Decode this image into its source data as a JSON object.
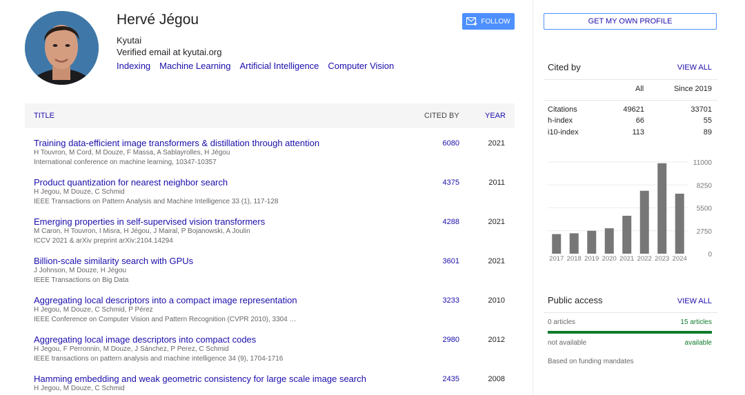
{
  "profile": {
    "name": "Hervé Jégou",
    "affiliation": "Kyutai",
    "email": "Verified email at kyutai.org",
    "interests": [
      "Indexing",
      "Machine Learning",
      "Artificial Intelligence",
      "Computer Vision"
    ],
    "follow_label": "FOLLOW"
  },
  "table": {
    "col_title": "TITLE",
    "col_cited": "CITED BY",
    "col_year": "YEAR",
    "rows": [
      {
        "title": "Training data-efficient image transformers & distillation through attention",
        "authors": "H Touvron, M Cord, M Douze, F Massa, A Sablayrolles, H Jégou",
        "venue": "International conference on machine learning, 10347-10357",
        "cited": "6080",
        "year": "2021"
      },
      {
        "title": "Product quantization for nearest neighbor search",
        "authors": "H Jegou, M Douze, C Schmid",
        "venue": "IEEE Transactions on Pattern Analysis and Machine Intelligence 33 (1), 117-128",
        "cited": "4375",
        "year": "2011"
      },
      {
        "title": "Emerging properties in self-supervised vision transformers",
        "authors": "M Caron, H Touvron, I Misra, H Jégou, J Mairal, P Bojanowski, A Joulin",
        "venue": "ICCV 2021 & arXiv preprint arXiv:2104.14294",
        "cited": "4288",
        "year": "2021"
      },
      {
        "title": "Billion-scale similarity search with GPUs",
        "authors": "J Johnson, M Douze, H Jégou",
        "venue": "IEEE Transactions on Big Data",
        "cited": "3601",
        "year": "2021"
      },
      {
        "title": "Aggregating local descriptors into a compact image representation",
        "authors": "H Jegou, M Douze, C Schmid, P Pérez",
        "venue": "IEEE Conference on Computer Vision and Pattern Recognition (CVPR 2010), 3304 …",
        "cited": "3233",
        "year": "2010"
      },
      {
        "title": "Aggregating local image descriptors into compact codes",
        "authors": "H Jegou, F Perronnin, M Douze, J Sánchez, P Perez, C Schmid",
        "venue": "IEEE transactions on pattern analysis and machine intelligence 34 (9), 1704-1716",
        "cited": "2980",
        "year": "2012"
      },
      {
        "title": "Hamming embedding and weak geometric consistency for large scale image search",
        "authors": "H Jegou, M Douze, C Schmid",
        "venue": "",
        "cited": "2435",
        "year": "2008"
      }
    ]
  },
  "sidebar": {
    "get_profile_label": "GET MY OWN PROFILE",
    "cited_by": {
      "title": "Cited by",
      "view_all": "VIEW ALL",
      "col_all": "All",
      "col_since": "Since 2019",
      "rows": [
        {
          "label": "Citations",
          "all": "49621",
          "since": "33701"
        },
        {
          "label": "h-index",
          "all": "66",
          "since": "55"
        },
        {
          "label": "i10-index",
          "all": "113",
          "since": "89"
        }
      ]
    },
    "public_access": {
      "title": "Public access",
      "view_all": "VIEW ALL",
      "not_available_count": "0 articles",
      "available_count": "15 articles",
      "not_available_label": "not available",
      "available_label": "available",
      "note": "Based on funding mandates",
      "available_fraction": 1.0
    }
  },
  "chart_data": {
    "type": "bar",
    "categories": [
      "2017",
      "2018",
      "2019",
      "2020",
      "2021",
      "2022",
      "2023",
      "2024"
    ],
    "values": [
      2350,
      2450,
      2750,
      3050,
      4550,
      7550,
      10850,
      7200
    ],
    "yticks": [
      "11000",
      "8250",
      "5500",
      "2750",
      "0"
    ],
    "ylim": [
      0,
      11000
    ],
    "bar_color": "#777777",
    "grid": true
  },
  "colors": {
    "link": "#1a0dab",
    "accent_blue": "#4d90fe",
    "available_green": "#0f7a2b"
  }
}
